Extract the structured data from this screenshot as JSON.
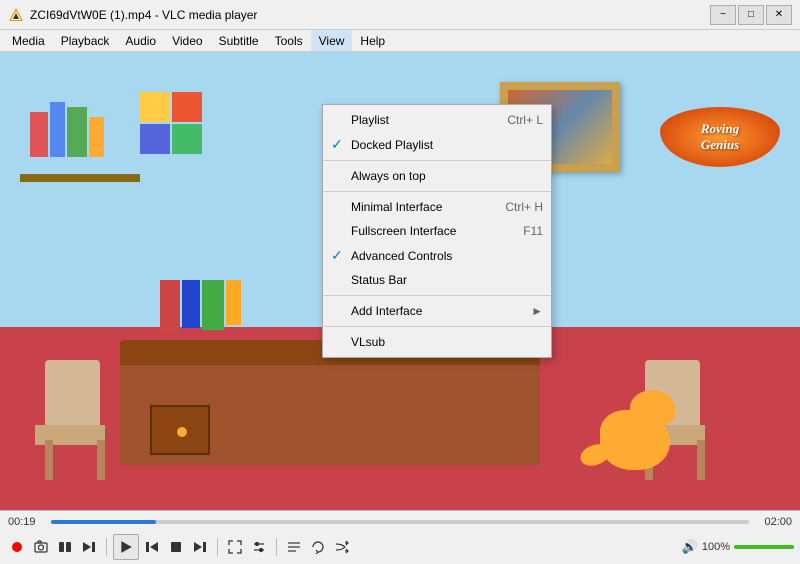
{
  "titlebar": {
    "title": "ZCI69dVtW0E (1).mp4 - VLC media player",
    "icon": "vlc"
  },
  "menubar": {
    "items": [
      "Media",
      "Playback",
      "Audio",
      "Video",
      "Subtitle",
      "Tools",
      "View",
      "Help"
    ]
  },
  "viewmenu": {
    "items": [
      {
        "id": "playlist",
        "label": "Playlist",
        "shortcut": "Ctrl+ L",
        "checked": false,
        "hasArrow": false
      },
      {
        "id": "docked-playlist",
        "label": "Docked Playlist",
        "shortcut": "",
        "checked": true,
        "hasArrow": false
      },
      {
        "id": "separator1"
      },
      {
        "id": "always-on-top",
        "label": "Always on top",
        "shortcut": "",
        "checked": false,
        "hasArrow": false
      },
      {
        "id": "separator2"
      },
      {
        "id": "minimal-interface",
        "label": "Minimal Interface",
        "shortcut": "Ctrl+ H",
        "checked": false,
        "hasArrow": false
      },
      {
        "id": "fullscreen-interface",
        "label": "Fullscreen Interface",
        "shortcut": "F11",
        "checked": false,
        "hasArrow": false
      },
      {
        "id": "advanced-controls",
        "label": "Advanced Controls",
        "shortcut": "",
        "checked": true,
        "hasArrow": false
      },
      {
        "id": "status-bar",
        "label": "Status Bar",
        "shortcut": "",
        "checked": false,
        "hasArrow": false
      },
      {
        "id": "separator3"
      },
      {
        "id": "add-interface",
        "label": "Add Interface",
        "shortcut": "",
        "checked": false,
        "hasArrow": true
      },
      {
        "id": "separator4"
      },
      {
        "id": "vlsub",
        "label": "VLsub",
        "shortcut": "",
        "checked": false,
        "hasArrow": false
      }
    ]
  },
  "player": {
    "timeLeft": "00:19",
    "timeRight": "02:00",
    "progressPercent": 15,
    "volumePercent": 100,
    "volumeLabel": "100%"
  },
  "logo": {
    "line1": "Roving",
    "line2": "Genius"
  }
}
